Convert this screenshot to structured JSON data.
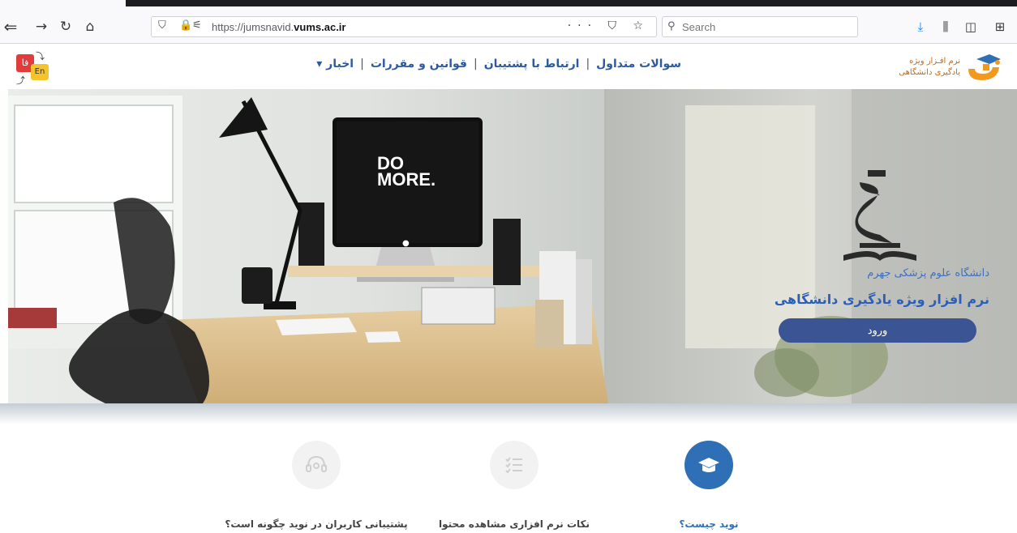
{
  "browser": {
    "url_prefix": "https://jumsnavid.",
    "url_domain": "vums.ac.ir",
    "url_actions": "··· ⛉ ☆",
    "search_placeholder": "Search"
  },
  "header": {
    "lang_fa": "فا",
    "lang_en": "En",
    "nav": [
      {
        "label": "سوالات متداول"
      },
      {
        "label": "ارتباط با پشتیبان"
      },
      {
        "label": "قوانین و مقررات"
      },
      {
        "label": "اخبار ▾"
      }
    ],
    "logo_line1": "نرم افـزار ویژه",
    "logo_line2": "یادگیری دانشگاهی"
  },
  "hero": {
    "monitor_text_line1": "DO",
    "monitor_text_line2": "MORE.",
    "university": "دانشگاه علوم پزشکی جهرم",
    "tagline": "نرم افزار ویژه یادگیری دانشگاهی",
    "login_label": "ورود"
  },
  "features": [
    {
      "label": "نوید چیست؟",
      "icon": "graduation-cap-icon",
      "active": true
    },
    {
      "label": "نکات نرم افزاری مشاهده محتوا",
      "icon": "checklist-icon",
      "active": false
    },
    {
      "label": "پشتیبانی کاربران در نوید چگونه است؟",
      "icon": "headset-icon",
      "active": false
    }
  ],
  "colors": {
    "brand_blue": "#2f6fb5",
    "login_button": "#3b5494",
    "logo_orange": "#f39a1e"
  }
}
